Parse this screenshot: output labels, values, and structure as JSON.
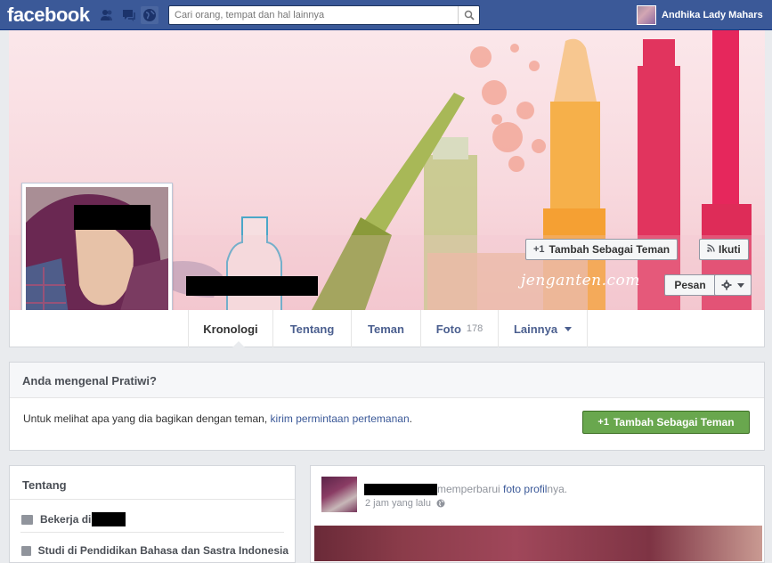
{
  "topbar": {
    "logo": "facebook",
    "search": {
      "placeholder": "Cari orang, tempat dan hal lainnya"
    },
    "user_name": "Andhika Lady Mahars",
    "icons": [
      "friend-requests-icon",
      "messages-icon",
      "notifications-globe-icon",
      "search-icon"
    ]
  },
  "cover": {
    "watermark": "jenganten.com",
    "add_friend_label": "Tambah Sebagai Teman",
    "add_friend_icon": "+1",
    "follow_label": "Ikuti",
    "follow_icon": "rss-icon",
    "message_label": "Pesan",
    "settings_icon": "gear-icon"
  },
  "nav": {
    "tabs": [
      {
        "label": "Kronologi",
        "active": true
      },
      {
        "label": "Tentang"
      },
      {
        "label": "Teman"
      },
      {
        "label": "Foto",
        "count": "178"
      },
      {
        "label": "Lainnya",
        "dropdown": true
      }
    ]
  },
  "know_panel": {
    "title": "Anda mengenal Pratiwi?",
    "text_prefix": "Untuk melihat apa yang dia bagikan dengan teman,",
    "link_text": "kirim permintaan pertemanan",
    "text_suffix": ".",
    "button_icon": "+1",
    "button_label": "Tambah Sebagai Teman"
  },
  "about": {
    "title": "Tentang",
    "rows": [
      {
        "icon": "briefcase-icon",
        "label": "Bekerja di"
      },
      {
        "icon": "education-icon",
        "label": "Studi di Pendidikan Bahasa dan Sastra Indonesia"
      }
    ]
  },
  "post": {
    "action_text": "memperbarui",
    "link_text": "foto profil",
    "suffix": "nya.",
    "time": "2 jam yang lalu",
    "privacy_icon": "globe-icon"
  },
  "colors": {
    "brand_blue": "#3b5998",
    "green_button": "#69a74e",
    "page_bg": "#e9ebee"
  }
}
